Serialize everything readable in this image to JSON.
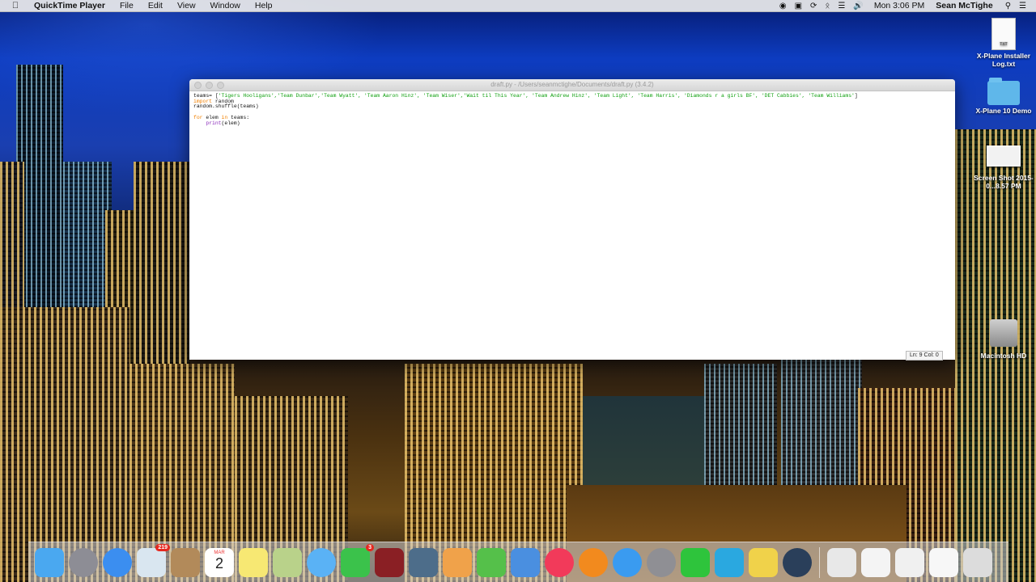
{
  "menubar": {
    "apple_icon": "apple-icon",
    "app_name": "QuickTime Player",
    "menus": [
      "File",
      "Edit",
      "View",
      "Window",
      "Help"
    ],
    "status_icons": [
      "record-icon",
      "script-icon",
      "time-machine-icon",
      "bluetooth-icon",
      "wifi-icon",
      "volume-icon"
    ],
    "clock": "Mon 3:06 PM",
    "user": "Sean McTighe",
    "search_icon": "spotlight-icon",
    "list_icon": "notification-center-icon"
  },
  "desktop": {
    "icons": [
      {
        "label": "X-Plane Installer Log.txt",
        "kind": "text-file-icon"
      },
      {
        "label": "X-Plane 10 Demo",
        "kind": "folder-icon"
      },
      {
        "label": "Screen Shot 2015-0...8.57 PM",
        "kind": "screenshot-icon"
      },
      {
        "label": "Macintosh HD",
        "kind": "hard-drive-icon"
      }
    ]
  },
  "window": {
    "title": "draft.py - /Users/seanmctighe/Documents/draft.py (3.4.2)",
    "code": {
      "line1_var": "teams= [",
      "line1_strings": "'Tigers Hooligans','Team Dunbar','Team Wyatt', 'Team Aaron Hinz', 'Team Wiser','Wait til This Year', 'Team Andrew Hinz', 'Team Light', 'Team Harris', 'Diamonds r a girls BF', 'DET Cabbies', 'Team Williams'",
      "line1_end": "]",
      "line2_kw": "import",
      "line2_rest": " random",
      "line3": "random.shuffle(teams)",
      "line5_kw1": "for",
      "line5_mid": " elem ",
      "line5_kw2": "in",
      "line5_rest": " teams:",
      "line6_indent": "    ",
      "line6_builtin": "print",
      "line6_rest": "(elem)"
    },
    "status": "Ln: 9 Col: 0"
  },
  "dock": {
    "apps": [
      {
        "name": "finder-icon",
        "color": "#4aa8f0"
      },
      {
        "name": "launchpad-icon",
        "color": "#8d8d95"
      },
      {
        "name": "safari-icon",
        "color": "#3b8ef0"
      },
      {
        "name": "mail-icon",
        "color": "#d9e6f0",
        "badge": "219"
      },
      {
        "name": "contacts-icon",
        "color": "#b28a5a"
      },
      {
        "name": "calendar-icon",
        "month": "MAR",
        "day": "2"
      },
      {
        "name": "notes-icon",
        "color": "#f7e873"
      },
      {
        "name": "preview-icon",
        "color": "#b9d28a"
      },
      {
        "name": "messages-icon",
        "color": "#5ab2f5"
      },
      {
        "name": "facetime-icon",
        "color": "#3bc24b",
        "badge": "3"
      },
      {
        "name": "photo-booth-icon",
        "color": "#8a1f24"
      },
      {
        "name": "iphoto-icon",
        "color": "#4d6d8a"
      },
      {
        "name": "pages-icon",
        "color": "#f0a24a"
      },
      {
        "name": "numbers-icon",
        "color": "#55c04a"
      },
      {
        "name": "keynote-icon",
        "color": "#4a8fe0"
      },
      {
        "name": "itunes-icon",
        "color": "#f23a5a"
      },
      {
        "name": "ibooks-icon",
        "color": "#f28a1e"
      },
      {
        "name": "app-store-icon",
        "color": "#3a9bf0"
      },
      {
        "name": "system-preferences-icon",
        "color": "#8f8f94"
      },
      {
        "name": "runner-icon",
        "color": "#2ec43c"
      },
      {
        "name": "checkmark-app-icon",
        "color": "#2aa8e0"
      },
      {
        "name": "python-launcher-icon",
        "color": "#f0d24a"
      },
      {
        "name": "quicktime-icon",
        "color": "#2a3f5a"
      }
    ],
    "right_items": [
      {
        "name": "documents-stack-icon",
        "color": "#e8e8e8"
      },
      {
        "name": "downloads-stack-icon",
        "color": "#f4f4f4"
      },
      {
        "name": "document-file-icon",
        "color": "#f0f0f0"
      },
      {
        "name": "screenshot-file-icon",
        "color": "#f7f7f7"
      },
      {
        "name": "trash-icon",
        "color": "#dcdcdc"
      }
    ]
  }
}
